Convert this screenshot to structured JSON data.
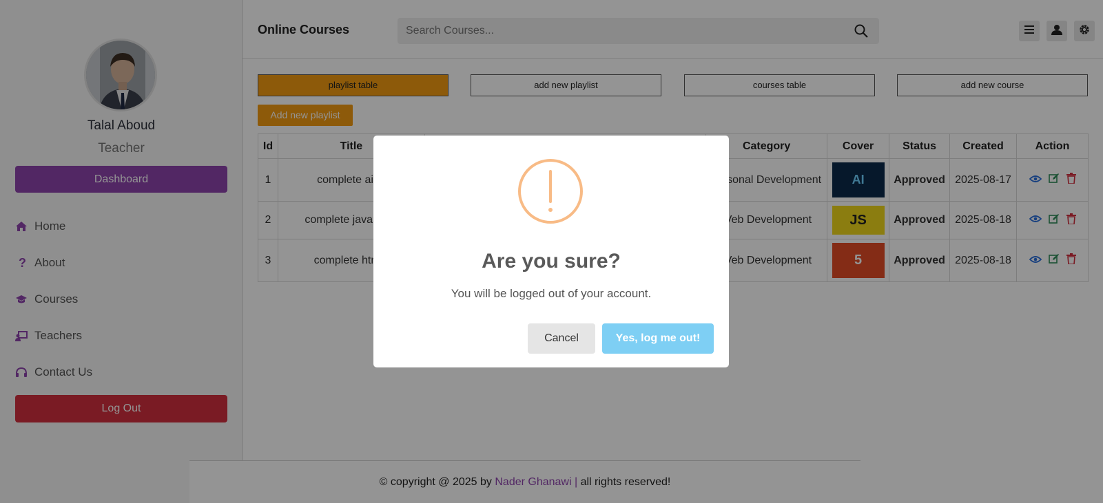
{
  "sidebar": {
    "profile_name": "Talal Aboud",
    "profile_role": "Teacher",
    "dashboard_label": "Dashboard",
    "nav": [
      {
        "label": "Home",
        "icon": "home-icon"
      },
      {
        "label": "About",
        "icon": "question-icon"
      },
      {
        "label": "Courses",
        "icon": "graduation-cap-icon"
      },
      {
        "label": "Teachers",
        "icon": "chalkboard-teacher-icon"
      },
      {
        "label": "Contact Us",
        "icon": "headset-icon"
      }
    ],
    "logout_label": "Log Out"
  },
  "header": {
    "brand": "Online Courses",
    "search_placeholder": "Search Courses...",
    "icons": [
      "menu-icon",
      "user-icon",
      "gear-icon"
    ]
  },
  "main": {
    "tabs": [
      "playlist table",
      "add new playlist",
      "courses table",
      "add new course"
    ],
    "active_tab": "playlist table",
    "add_playlist_label": "Add new playlist",
    "table": {
      "columns": [
        "Id",
        "Title",
        "",
        "Category",
        "Cover",
        "Status",
        "Created",
        "Action"
      ],
      "rows": [
        {
          "id": "1",
          "title": "complete ai tu",
          "category": "sonal Development",
          "cover": "AI",
          "status": "Approved",
          "created": "2025-08-17"
        },
        {
          "id": "2",
          "title": "complete javaScrip",
          "category": "Veb Development",
          "cover": "JS",
          "status": "Approved",
          "created": "2025-08-18"
        },
        {
          "id": "3",
          "title": "complete html t",
          "category": "Veb Development",
          "cover": "5",
          "status": "Approved",
          "created": "2025-08-18"
        }
      ]
    }
  },
  "footer": {
    "prefix": "© copyright @ 2025 by",
    "author": "Nader Ghanawi |",
    "suffix": "all rights reserved!"
  },
  "modal": {
    "icon": "warning-icon",
    "title": "Are you sure?",
    "text": "You will be logged out of your account.",
    "cancel_label": "Cancel",
    "confirm_label": "Yes, log me out!"
  },
  "colors": {
    "accent": "#8e44ad",
    "danger": "#d32f3e",
    "warning": "#f39c12",
    "confirm": "#7ecff4"
  }
}
